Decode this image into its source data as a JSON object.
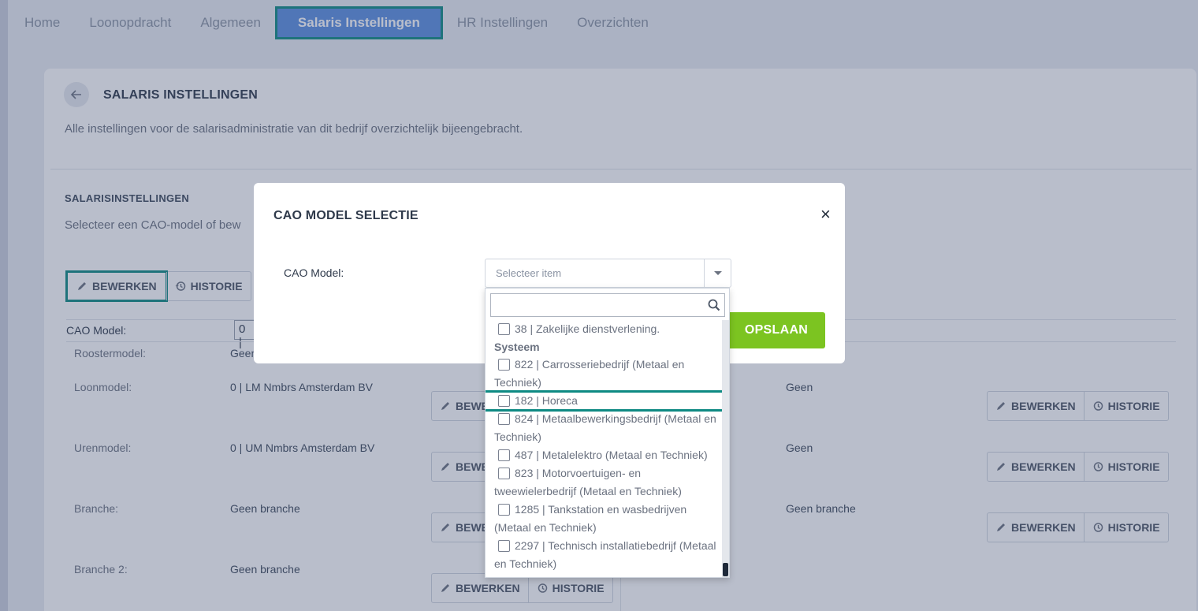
{
  "nav": {
    "items": [
      "Home",
      "Loonopdracht",
      "Algemeen",
      "Salaris Instellingen",
      "HR Instellingen",
      "Overzichten"
    ]
  },
  "page": {
    "title": "SALARIS INSTELLINGEN",
    "description": "Alle instellingen voor de salarisadministratie van dit bedrijf overzichtelijk bijeengebracht.",
    "section_title": "SALARISINSTELLINGEN",
    "section_desc": "Selecteer een CAO-model of bew"
  },
  "toolbar": {
    "edit_label": "BEWERKEN",
    "history_label": "HISTORIE"
  },
  "cao": {
    "label": "CAO Model:",
    "value": "0 |"
  },
  "rows": [
    {
      "label": "Roostermodel:",
      "value": "Geen"
    },
    {
      "label": "Loonmodel:",
      "value": "0 | LM Nmbrs Amsterdam BV",
      "right_value": "Geen"
    },
    {
      "label": "Urenmodel:",
      "value": "0 | UM Nmbrs Amsterdam BV",
      "right_value": "Geen"
    },
    {
      "label": "Branche:",
      "value": "Geen branche",
      "right_value": "Geen branche"
    },
    {
      "label": "Branche 2:",
      "value": "Geen branche"
    }
  ],
  "row_buttons": {
    "edit_partial": "BEWE",
    "edit_full": "BEWERKEN",
    "history": "HISTORIE"
  },
  "modal": {
    "title": "CAO MODEL SELECTIE",
    "close": "×",
    "field_label": "CAO Model:",
    "select_placeholder": "Selecteer item",
    "save_label": "OPSLAAN"
  },
  "dropdown": {
    "search_value": "",
    "options_before": [
      "38 | Zakelijke dienstverlening."
    ],
    "group": "Systeem",
    "options": [
      "822 | Carrosseriebedrijf (Metaal en Techniek)",
      "182 | Horeca",
      "824 | Metaalbewerkingsbedrijf (Metaal en Techniek)",
      "487 | Metalelektro (Metaal en Techniek)",
      "823 | Motorvoertuigen- en tweewielerbedrijf (Metaal en Techniek)",
      "1285 | Tankstation en wasbedrijven (Metaal en Techniek)",
      "2297 | Technisch installatiebedrijf (Metaal en Techniek)"
    ],
    "highlighted_option": "182 | Horeca"
  },
  "icons": {
    "edit": "pencil-icon",
    "history": "history-icon",
    "back": "arrow-left-icon",
    "search": "search-icon",
    "close": "close-icon"
  },
  "colors": {
    "accent": "#5b8fe0",
    "highlight": "#0e8a83",
    "save": "#7cc421"
  }
}
